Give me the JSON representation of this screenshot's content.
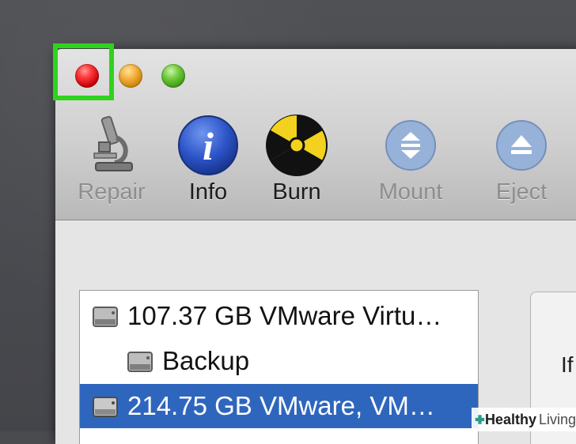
{
  "toolbar": {
    "tools": [
      {
        "label": "Repair",
        "icon": "microscope-icon",
        "enabled": false
      },
      {
        "label": "Info",
        "icon": "info-icon",
        "enabled": true
      },
      {
        "label": "Burn",
        "icon": "radiation-icon",
        "enabled": true
      },
      {
        "label": "Mount",
        "icon": "mount-icon",
        "enabled": false
      },
      {
        "label": "Eject",
        "icon": "eject-icon",
        "enabled": false
      }
    ]
  },
  "sidebar": {
    "items": [
      {
        "label": "107.37 GB VMware Virtu…",
        "icon": "hard-drive-icon",
        "selected": false
      },
      {
        "label": "Backup",
        "icon": "hard-drive-icon",
        "selected": false
      },
      {
        "label": "214.75 GB VMware, VM…",
        "icon": "hard-drive-icon",
        "selected": true
      }
    ]
  },
  "info_panel": {
    "text": "If"
  },
  "watermark": {
    "bold": "Healthy",
    "light": "Living"
  },
  "colors": {
    "highlight": "#2fd31d",
    "selection": "#2f66bd",
    "close": "#ff3b3b",
    "minimize": "#f5b240",
    "zoom": "#74cc3e"
  }
}
